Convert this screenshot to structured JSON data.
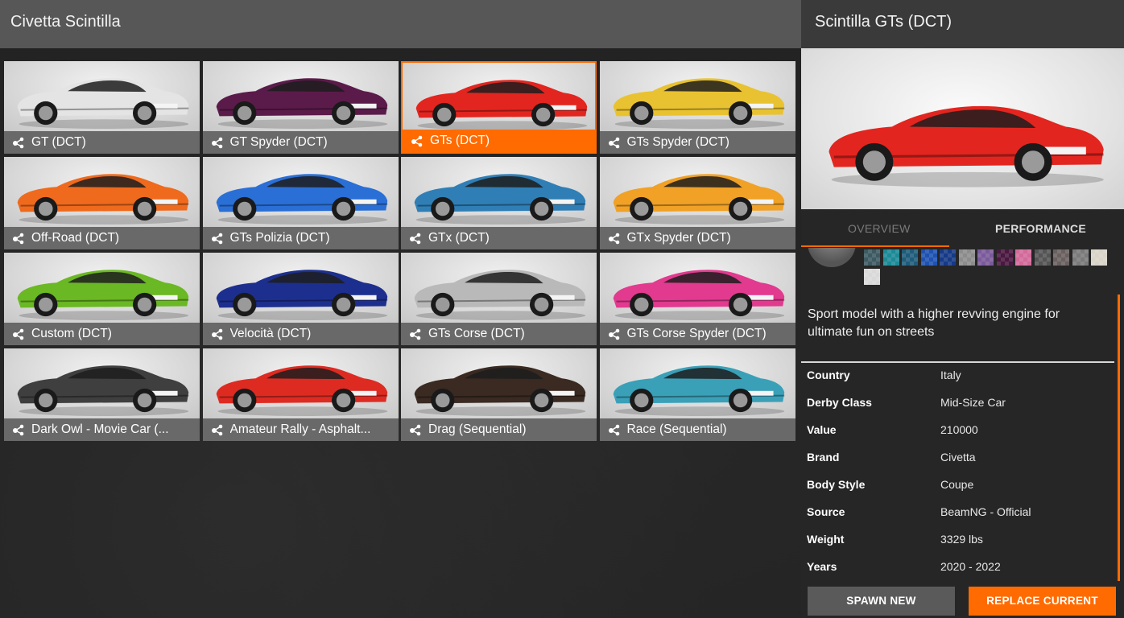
{
  "left": {
    "title": "Civetta Scintilla"
  },
  "tiles": [
    {
      "name": "GT (DCT)",
      "color": "#e4e4e4",
      "selected": false
    },
    {
      "name": "GT Spyder (DCT)",
      "color": "#5b1b4a",
      "selected": false
    },
    {
      "name": "GTs (DCT)",
      "color": "#e3251f",
      "selected": true
    },
    {
      "name": "GTs Spyder (DCT)",
      "color": "#e9c231",
      "selected": false
    },
    {
      "name": "Off-Road (DCT)",
      "color": "#ef6a1d",
      "selected": false
    },
    {
      "name": "GTs Polizia (DCT)",
      "color": "#2a6fd6",
      "selected": false
    },
    {
      "name": "GTx (DCT)",
      "color": "#2f7fb6",
      "selected": false
    },
    {
      "name": "GTx Spyder (DCT)",
      "color": "#f0a126",
      "selected": false
    },
    {
      "name": "Custom (DCT)",
      "color": "#6ab823",
      "selected": false
    },
    {
      "name": "Velocità (DCT)",
      "color": "#1d2f8e",
      "selected": false
    },
    {
      "name": "GTs Corse (DCT)",
      "color": "#b9b9b9",
      "selected": false
    },
    {
      "name": "GTs Corse Spyder (DCT)",
      "color": "#e23a8f",
      "selected": false
    },
    {
      "name": "Dark Owl - Movie Car (...",
      "color": "#3f3f3f",
      "selected": false
    },
    {
      "name": "Amateur Rally - Asphalt...",
      "color": "#de2b22",
      "selected": false
    },
    {
      "name": "Drag (Sequential)",
      "color": "#3a2a22",
      "selected": false
    },
    {
      "name": "Race (Sequential)",
      "color": "#3aa0b8",
      "selected": false
    }
  ],
  "detail": {
    "title": "Scintilla GTs (DCT)",
    "preview_color": "#e3251f",
    "tabs": {
      "overview": "OVERVIEW",
      "performance": "PERFORMANCE"
    },
    "swatches": [
      "#3d5a62",
      "#1d8a96",
      "#1f5c7a",
      "#1f52b0",
      "#173a86",
      "#8c8c8c",
      "#7a5a9a",
      "#4a1840",
      "#d36a9a",
      "#555555",
      "#6a6060",
      "#7a7a7a",
      "#d8d4c8",
      "#d9d9d9"
    ],
    "description": "Sport model with a higher revving engine for ultimate fun on streets",
    "info": [
      {
        "key": "Country",
        "value": "Italy"
      },
      {
        "key": "Derby Class",
        "value": "Mid-Size Car"
      },
      {
        "key": "Value",
        "value": "210000"
      },
      {
        "key": "Brand",
        "value": "Civetta"
      },
      {
        "key": "Body Style",
        "value": "Coupe"
      },
      {
        "key": "Source",
        "value": "BeamNG - Official"
      },
      {
        "key": "Weight",
        "value": "3329 lbs"
      },
      {
        "key": "Years",
        "value": "2020 - 2022"
      }
    ],
    "buttons": {
      "spawn": "SPAWN NEW",
      "replace": "REPLACE CURRENT"
    }
  }
}
